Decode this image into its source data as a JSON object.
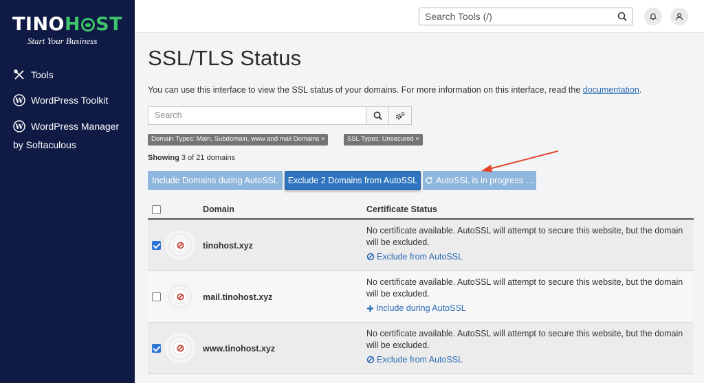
{
  "brand": {
    "logo_part1": "TINO",
    "logo_part2": "H",
    "logo_part3": "ST",
    "tagline": "Start Your Business",
    "accent": "#3ec26a",
    "sidebar_bg": "#0f1b45"
  },
  "sidebar": {
    "items": [
      {
        "label": "Tools",
        "icon": "tools-icon"
      },
      {
        "label": "WordPress Toolkit",
        "icon": "wordpress-icon"
      },
      {
        "label": "WordPress Manager",
        "sub": "by Softaculous",
        "icon": "wordpress-icon"
      }
    ]
  },
  "topbar": {
    "search_placeholder": "Search Tools (/)",
    "bell": "bell-icon",
    "user": "user-icon"
  },
  "page": {
    "title": "SSL/TLS Status",
    "intro": "You can use this interface to view the SSL status of your domains. For more information on this interface, read the",
    "intro_link": "documentation",
    "intro_end": "."
  },
  "search": {
    "placeholder": "Search"
  },
  "filters": [
    {
      "label": "Domain Types: Main, Subdomain, www and mail Domains ×"
    },
    {
      "label": "SSL Types: Unsecured ×"
    }
  ],
  "showing": {
    "label": "Showing",
    "text": "3 of 21 domains"
  },
  "actions": {
    "include": "Include Domains during AutoSSL",
    "exclude": "Exclude 2 Domains from AutoSSL",
    "progress": "AutoSSL is in progress …"
  },
  "table": {
    "headers": {
      "domain": "Domain",
      "status": "Certificate Status"
    },
    "rows": [
      {
        "checked": true,
        "domain": "tinohost.xyz",
        "status": "No certificate available. AutoSSL will attempt to secure this website, but the domain will be excluded.",
        "action": "Exclude from AutoSSL",
        "action_icon": "ban-icon"
      },
      {
        "checked": false,
        "domain": "mail.tinohost.xyz",
        "status": "No certificate available. AutoSSL will attempt to secure this website, but the domain will be excluded.",
        "action": "Include during AutoSSL",
        "action_icon": "plus-icon"
      },
      {
        "checked": true,
        "domain": "www.tinohost.xyz",
        "status": "No certificate available. AutoSSL will attempt to secure this website, but the domain will be excluded.",
        "action": "Exclude from AutoSSL",
        "action_icon": "ban-icon"
      }
    ]
  },
  "colors": {
    "link": "#2a6bb5",
    "primary_button": "#2f74bf",
    "light_button": "#8fb6dc",
    "arrow": "#e0452a",
    "unsecured_icon": "#c0392b"
  }
}
